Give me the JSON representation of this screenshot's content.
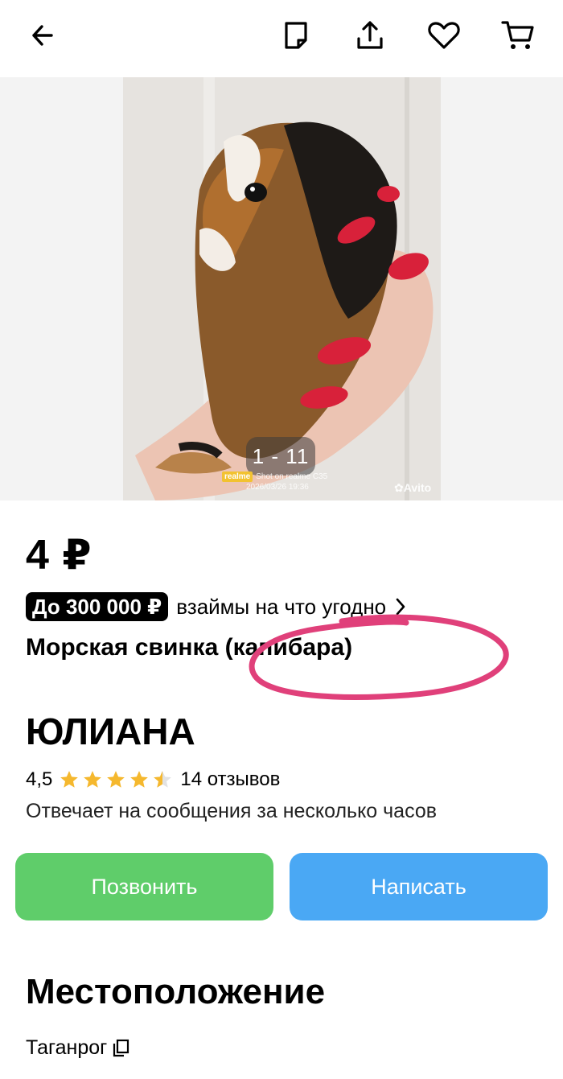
{
  "header": {
    "icons": [
      "back-arrow-icon",
      "note-icon",
      "share-icon",
      "heart-icon",
      "cart-icon"
    ]
  },
  "gallery": {
    "counter": "1 - 11",
    "watermark_brand": "realme",
    "watermark_text": "Shot on realme C35",
    "watermark_date": "2026/03/26  19:36",
    "avito_mark": "Avito"
  },
  "listing": {
    "price": "4 ₽",
    "loan_badge": "До 300 000 ₽",
    "loan_text": "взаймы на что угодно",
    "title": "Морская свинка (капибара)"
  },
  "seller": {
    "name": "ЮЛИАНА",
    "rating": "4,5",
    "stars_value": 4.5,
    "reviews": "14 отзывов",
    "response": "Отвечает на сообщения за несколько часов"
  },
  "actions": {
    "call_label": "Позвонить",
    "message_label": "Написать"
  },
  "location": {
    "heading": "Местоположение",
    "city": "Таганрог"
  },
  "colors": {
    "call": "#5fcd6a",
    "message": "#4aa8f4",
    "star": "#f5b82e",
    "annotation": "#e0407a"
  }
}
